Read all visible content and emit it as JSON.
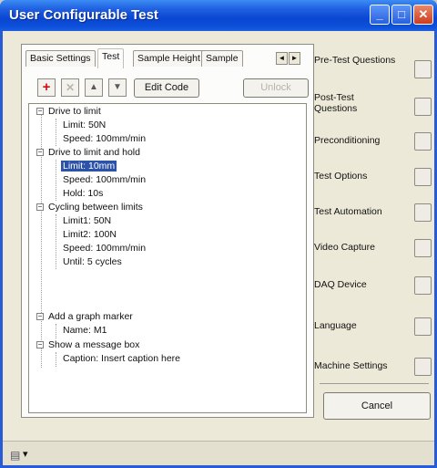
{
  "window": {
    "title": "User Configurable Test"
  },
  "titlebar_buttons": {
    "minimize": "_",
    "maximize": "□",
    "close": "✕"
  },
  "tabs": [
    {
      "label": "Basic Settings",
      "active": false
    },
    {
      "label": "Test",
      "active": true
    },
    {
      "label": "Sample Height",
      "active": false
    },
    {
      "label": "Sample",
      "active": false
    }
  ],
  "tab_scroll": {
    "left": "◄",
    "right": "►"
  },
  "toolbar": {
    "add_icon": "+",
    "delete_icon": "✕",
    "up_icon": "▲",
    "down_icon": "▼",
    "edit_code_label": "Edit Code",
    "disabled_label": "Unlock"
  },
  "tree": [
    {
      "label": "Drive to limit",
      "level": 0,
      "expander": "−"
    },
    {
      "label": "Limit: 50N",
      "level": 1
    },
    {
      "label": "Speed: 100mm/min",
      "level": 1
    },
    {
      "label": "Drive to limit and hold",
      "level": 0,
      "expander": "−"
    },
    {
      "label": "Limit: 10mm",
      "level": 1,
      "selected": true
    },
    {
      "label": "Speed: 100mm/min",
      "level": 1
    },
    {
      "label": "Hold: 10s",
      "level": 1
    },
    {
      "label": "Cycling between limits",
      "level": 0,
      "expander": "−"
    },
    {
      "label": "Limit1: 50N",
      "level": 1
    },
    {
      "label": "Limit2: 100N",
      "level": 1
    },
    {
      "label": "Speed: 100mm/min",
      "level": 1
    },
    {
      "label": "Until: 5 cycles",
      "level": 1
    },
    {
      "label": "Add a graph marker",
      "level": 0,
      "expander": "−"
    },
    {
      "label": "Name: M1",
      "level": 1
    },
    {
      "label": "Show a message box",
      "level": 0,
      "expander": "−"
    },
    {
      "label": "Caption: Insert caption here",
      "level": 1
    }
  ],
  "side_items": [
    {
      "label": "Pre-Test Questions"
    },
    {
      "label": "Post-Test Questions"
    },
    {
      "label": "Preconditioning"
    },
    {
      "label": "Test Options"
    },
    {
      "label": "Test Automation"
    },
    {
      "label": "Video Capture"
    },
    {
      "label": "DAQ Device"
    },
    {
      "label": "Language"
    },
    {
      "label": "Machine Settings"
    }
  ],
  "cancel_label": "Cancel",
  "status": {
    "icon": "status-icon",
    "dropdown_glyph": "▾"
  },
  "colors": {
    "title_bar": "#0a46d2",
    "selection": "#2d53a8",
    "window_bg": "#ece9d8"
  }
}
